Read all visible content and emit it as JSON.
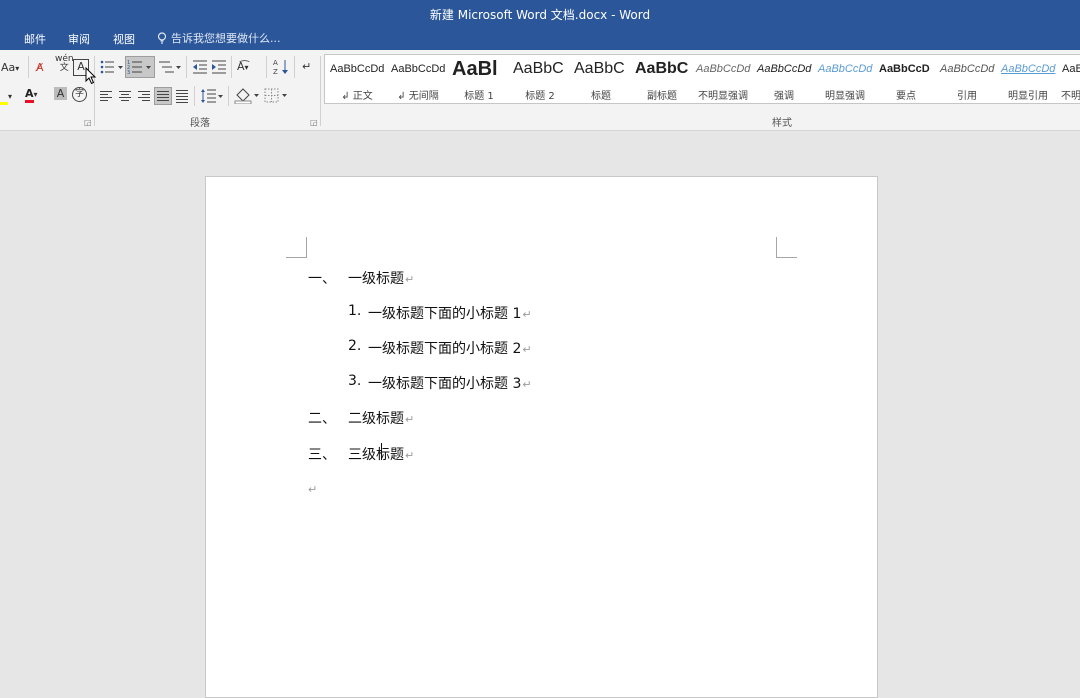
{
  "window": {
    "title": "新建 Microsoft Word 文档.docx - Word"
  },
  "tabs": [
    "邮件",
    "审阅",
    "视图"
  ],
  "tell_me": "告诉我您想要做什么...",
  "ribbon": {
    "font_size_label": "Aa",
    "phonetic_top": "wén",
    "phonetic_char": "文",
    "border_char": "A",
    "font_color_char": "A",
    "shade_char": "A",
    "circle_char": "字",
    "paragraph_group": "段落",
    "styles_group": "样式"
  },
  "styles": [
    {
      "preview": "AaBbCcDd",
      "name": "↲ 正文"
    },
    {
      "preview": "AaBbCcDd",
      "name": "↲ 无间隔"
    },
    {
      "preview": "AaBl",
      "name": "标题 1"
    },
    {
      "preview": "AaBbC",
      "name": "标题 2"
    },
    {
      "preview": "AaBbC",
      "name": "标题"
    },
    {
      "preview": "AaBbC",
      "name": "副标题"
    },
    {
      "preview": "AaBbCcDd",
      "name": "不明显强调"
    },
    {
      "preview": "AaBbCcDd",
      "name": "强调"
    },
    {
      "preview": "AaBbCcDd",
      "name": "明显强调"
    },
    {
      "preview": "AaBbCcD",
      "name": "要点"
    },
    {
      "preview": "AaBbCcDd",
      "name": "引用"
    },
    {
      "preview": "AaBbCcDd",
      "name": "明显引用"
    },
    {
      "preview": "AaBl",
      "name": "不明"
    }
  ],
  "document": {
    "items": [
      {
        "num": "一、",
        "text": "一级标题"
      },
      {
        "num": "1.",
        "text": "一级标题下面的小标题 1"
      },
      {
        "num": "2.",
        "text": "一级标题下面的小标题 2"
      },
      {
        "num": "3.",
        "text": "一级标题下面的小标题 3"
      },
      {
        "num": "二、",
        "text": "二级标题"
      },
      {
        "num": "三、",
        "text": "三级标题"
      }
    ],
    "para_mark": "↵"
  },
  "colors": {
    "accent": "#2b579a",
    "font_red": "#e81123",
    "highlight_yellow": "#ffff00"
  }
}
